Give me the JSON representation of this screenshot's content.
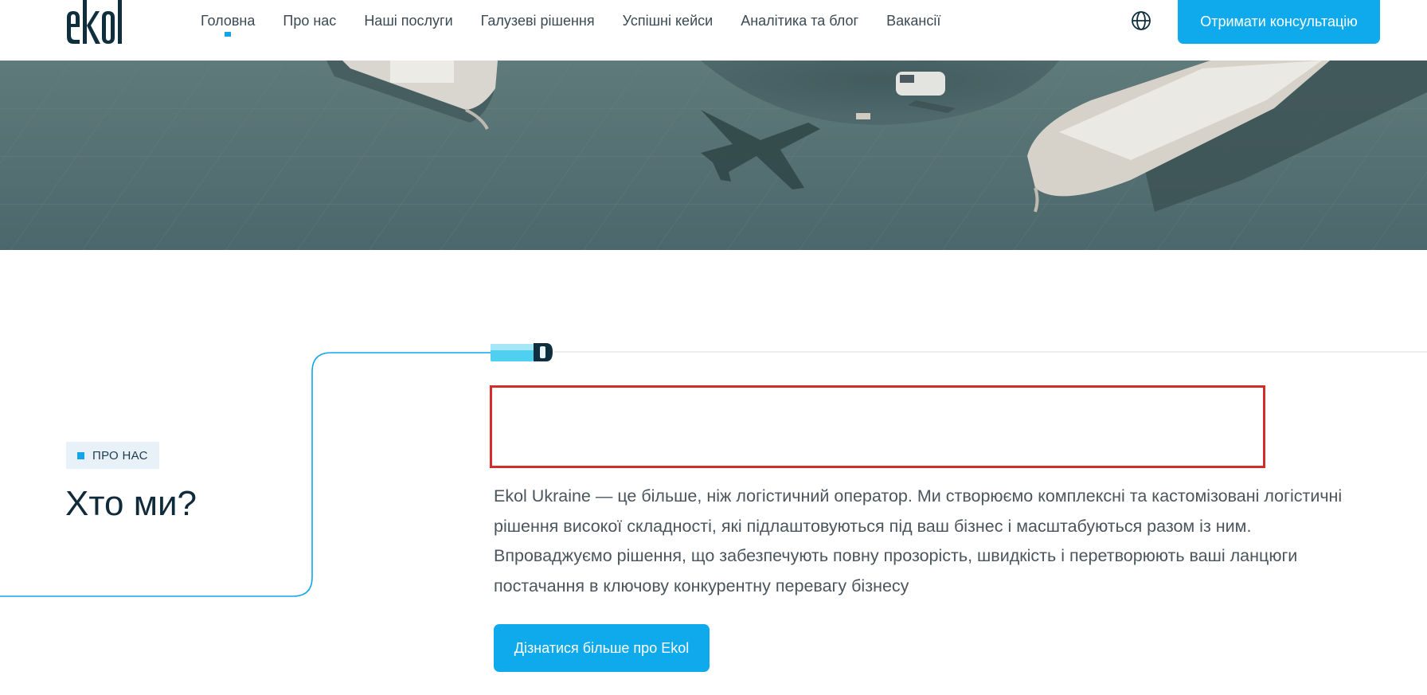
{
  "header": {
    "nav": [
      {
        "label": "Головна",
        "active": true
      },
      {
        "label": "Про нас"
      },
      {
        "label": "Наші послуги"
      },
      {
        "label": "Галузеві рішення"
      },
      {
        "label": "Успішні кейси"
      },
      {
        "label": "Аналітика та блог"
      },
      {
        "label": "Вакансії"
      }
    ],
    "language_icon": "globe-icon",
    "cta_label": "Отримати консультацію"
  },
  "about": {
    "badge": "ПРО НАС",
    "title": "Хто ми?",
    "description": "Ekol Ukraine — це більше, ніж логістичний оператор. Ми створюємо комплексні та кастомізовані логістичні рішення високої складності, які підлаштовуються під ваш бізнес і масштабуються разом із ним. Впроваджуємо рішення, що забезпечують повну прозорість, швидкість і перетворюють ваші ланцюги постачання в ключову конкурентну перевагу бізнесу",
    "button_label": "Дізнатися більше про Ekol"
  },
  "colors": {
    "accent": "#0eaaeb",
    "dark_text": "#0f2a3a",
    "highlight_border": "#d62b2b"
  }
}
